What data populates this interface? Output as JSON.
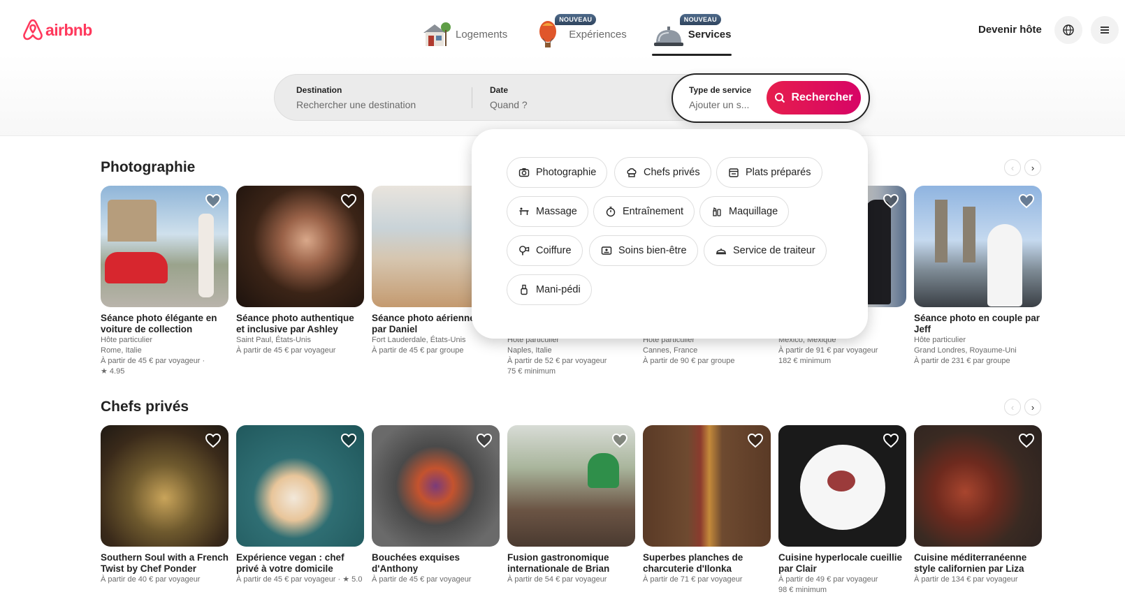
{
  "brand": {
    "name": "airbnb",
    "color": "#ff385c"
  },
  "nav": {
    "tabs": [
      {
        "label": "Logements",
        "icon": "house-icon",
        "badge": "",
        "active": false
      },
      {
        "label": "Expériences",
        "icon": "hot-air-balloon-icon",
        "badge": "NOUVEAU",
        "active": false
      },
      {
        "label": "Services",
        "icon": "service-bell-icon",
        "badge": "NOUVEAU",
        "active": true
      }
    ],
    "host_label": "Devenir hôte",
    "globe_icon": "globe-icon",
    "menu_icon": "hamburger-menu-icon"
  },
  "search": {
    "destination": {
      "label": "Destination",
      "placeholder": "Rechercher une destination"
    },
    "date": {
      "label": "Date",
      "placeholder": "Quand ?"
    },
    "service_type": {
      "label": "Type de service",
      "placeholder": "Ajouter un s..."
    },
    "button_label": "Rechercher",
    "button_color": "#e61e4d"
  },
  "service_menu": {
    "items": [
      {
        "label": "Photographie",
        "icon": "camera-icon"
      },
      {
        "label": "Chefs privés",
        "icon": "chef-hat-icon"
      },
      {
        "label": "Plats préparés",
        "icon": "meal-box-icon"
      },
      {
        "label": "Massage",
        "icon": "massage-table-icon"
      },
      {
        "label": "Entraînement",
        "icon": "stopwatch-icon"
      },
      {
        "label": "Maquillage",
        "icon": "makeup-icon"
      },
      {
        "label": "Coiffure",
        "icon": "hair-dryer-icon"
      },
      {
        "label": "Soins bien-être",
        "icon": "wellness-icon"
      },
      {
        "label": "Service de traiteur",
        "icon": "catering-icon"
      },
      {
        "label": "Mani-pédi",
        "icon": "nail-polish-icon"
      }
    ]
  },
  "sections": [
    {
      "title": "Photographie",
      "cards": [
        {
          "title": "Séance photo élégante en voiture de collection",
          "lines": [
            "Hôte particulier",
            "Rome, Italie",
            "À partir de 45 € par voyageur ·",
            "★ 4.95"
          ]
        },
        {
          "title": "Séance photo authentique et inclusive par Ashley",
          "lines": [
            "Saint Paul, États-Unis",
            "À partir de 45 € par voyageur"
          ]
        },
        {
          "title": "Séance photo aérienne sol par Daniel",
          "lines": [
            "Fort Lauderdale, États-Unis",
            "À partir de 45 € par groupe"
          ]
        },
        {
          "title": "",
          "lines": [
            "Hôte particulier",
            "Naples, Italie",
            "À partir de 52 € par voyageur",
            "75 € minimum"
          ]
        },
        {
          "title": "",
          "lines": [
            "Hôte particulier",
            "Cannes, France",
            "À partir de 90 € par groupe"
          ]
        },
        {
          "title": "",
          "lines": [
            "Mexico, Mexique",
            "À partir de 91 € par voyageur",
            "182 € minimum"
          ]
        },
        {
          "title": "Séance photo en couple par Jeff",
          "lines": [
            "Hôte particulier",
            "Grand Londres, Royaume-Uni",
            "À partir de 231 € par groupe"
          ]
        }
      ]
    },
    {
      "title": "Chefs privés",
      "cards": [
        {
          "title": "Southern Soul with a French Twist by Chef Ponder",
          "lines": [
            "À partir de 40 € par voyageur"
          ]
        },
        {
          "title": "Expérience vegan : chef privé à votre domicile",
          "lines": [
            "À partir de 45 € par voyageur · ★ 5.0"
          ]
        },
        {
          "title": "Bouchées exquises d'Anthony",
          "lines": [
            "À partir de 45 € par voyageur"
          ]
        },
        {
          "title": "Fusion gastronomique internationale de Brian",
          "lines": [
            "À partir de 54 € par voyageur"
          ]
        },
        {
          "title": "Superbes planches de charcuterie d'Ilonka",
          "lines": [
            "À partir de 71 € par voyageur"
          ]
        },
        {
          "title": "Cuisine hyperlocale cueillie par Clair",
          "lines": [
            "À partir de 49 € par voyageur",
            "98 € minimum"
          ]
        },
        {
          "title": "Cuisine méditerranéenne style californien par Liza",
          "lines": [
            "À partir de 134 € par voyageur"
          ]
        }
      ]
    }
  ],
  "arrows": {
    "prev": "‹",
    "next": "›"
  }
}
